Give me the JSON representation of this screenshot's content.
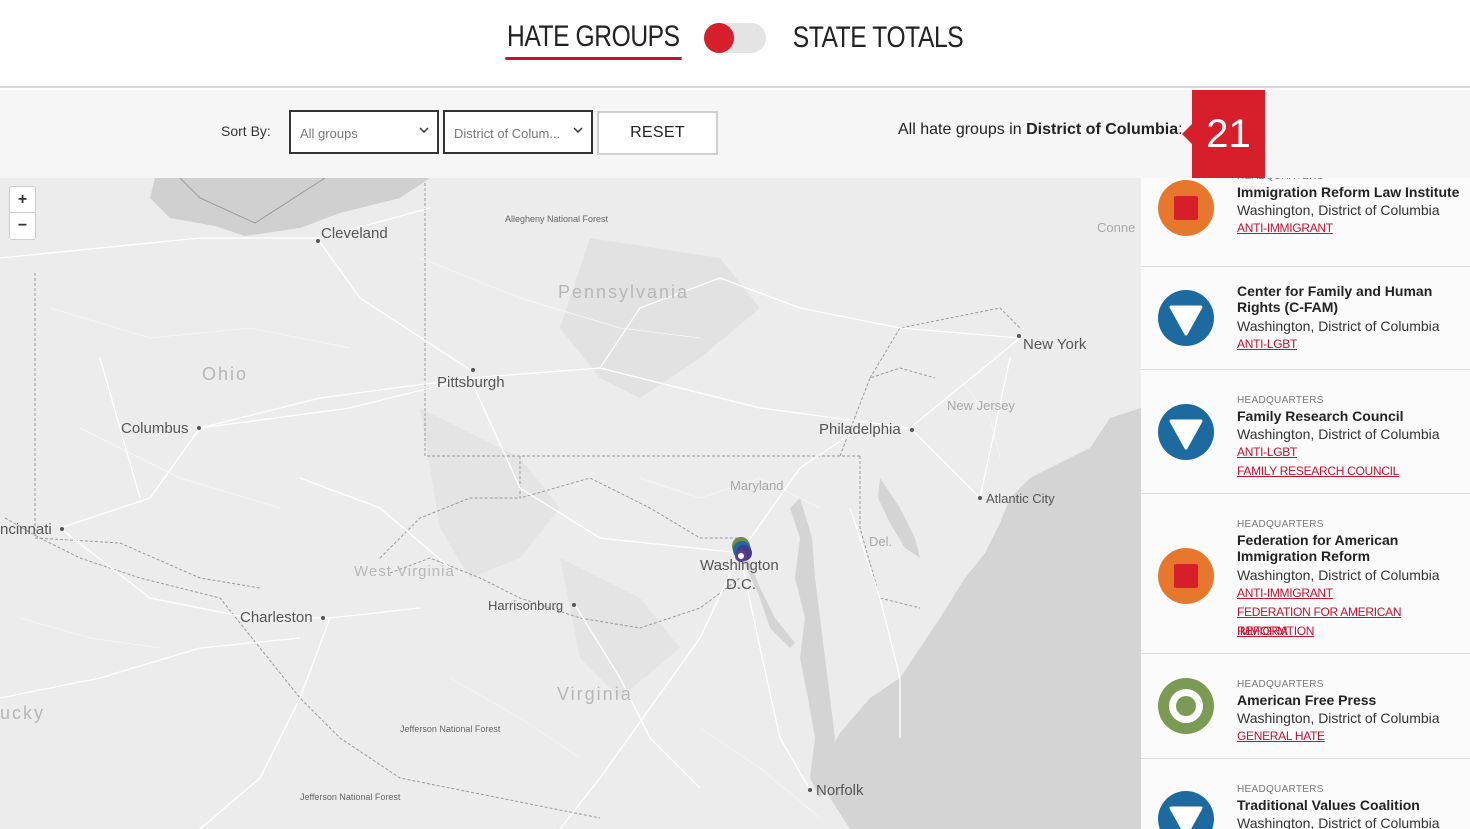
{
  "header": {
    "tab_hate": "HATE GROUPS",
    "tab_state": "STATE TOTALS"
  },
  "filters": {
    "sort_label": "Sort By:",
    "group_select": "All groups",
    "state_select": "District of Colum...",
    "reset": "RESET",
    "count_prefix": "All hate groups in",
    "count_state": "District of Columbia",
    "count_suffix": ":",
    "count": "21"
  },
  "map": {
    "zoom_in": "+",
    "zoom_out": "−",
    "labels": {
      "cleveland": "Cleveland",
      "allegheny": "Allegheny National Forest",
      "pennsylvania": "Pennsylvania",
      "ohio": "Ohio",
      "pittsburgh": "Pittsburgh",
      "columbus": "Columbus",
      "new_york": "New York",
      "new_jersey": "New Jersey",
      "philadelphia": "Philadelphia",
      "maryland": "Maryland",
      "atlantic_city": "Atlantic City",
      "cincinnati": "ncinnati",
      "washington": "Washington",
      "dc": "D.C.",
      "del": "Del.",
      "west_virginia": "West Virginia",
      "charleston": "Charleston",
      "harrisonburg": "Harrisonburg",
      "virginia": "Virginia",
      "kentucky": "ucky",
      "jefferson1": "Jefferson National Forest",
      "jefferson2": "Jefferson National Forest",
      "norfolk": "Norfolk",
      "conn": "Conne"
    }
  },
  "groups": [
    {
      "hq": "HEADQUARTERS",
      "name": "Immigration Reform Law Institute",
      "location": "Washington, District of Columbia",
      "tags": [
        "ANTI-IMMIGRANT"
      ],
      "icon": "square-icon",
      "color": "#e8772e"
    },
    {
      "hq": "",
      "name": "Center for Family and Human Rights (C-FAM)",
      "location": "Washington, District of Columbia",
      "tags": [
        "ANTI-LGBT"
      ],
      "icon": "triangle-icon",
      "color": "#1c6aa0"
    },
    {
      "hq": "HEADQUARTERS",
      "name": "Family Research Council",
      "location": "Washington, District of Columbia",
      "tags": [
        "ANTI-LGBT",
        "FAMILY RESEARCH COUNCIL"
      ],
      "icon": "triangle-icon",
      "color": "#1c6aa0"
    },
    {
      "hq": "HEADQUARTERS",
      "name": "Federation for American Immigration Reform",
      "location": "Washington, District of Columbia",
      "tags": [
        "ANTI-IMMIGRANT",
        "FEDERATION FOR AMERICAN IMMIGRATION",
        "REFORM"
      ],
      "icon": "square-icon",
      "color": "#e8772e"
    },
    {
      "hq": "HEADQUARTERS",
      "name": "American Free Press",
      "location": "Washington, District of Columbia",
      "tags": [
        "GENERAL HATE"
      ],
      "icon": "target-icon",
      "color": "#7b9a53"
    },
    {
      "hq": "HEADQUARTERS",
      "name": "Traditional Values Coalition",
      "location": "Washington, District of Columbia",
      "tags": [],
      "icon": "triangle-icon",
      "color": "#1c6aa0"
    }
  ],
  "colors": {
    "accent": "#d71f2b",
    "anti_immigrant": "#e8772e",
    "anti_lgbt": "#1c6aa0",
    "general_hate": "#7b9a53"
  }
}
